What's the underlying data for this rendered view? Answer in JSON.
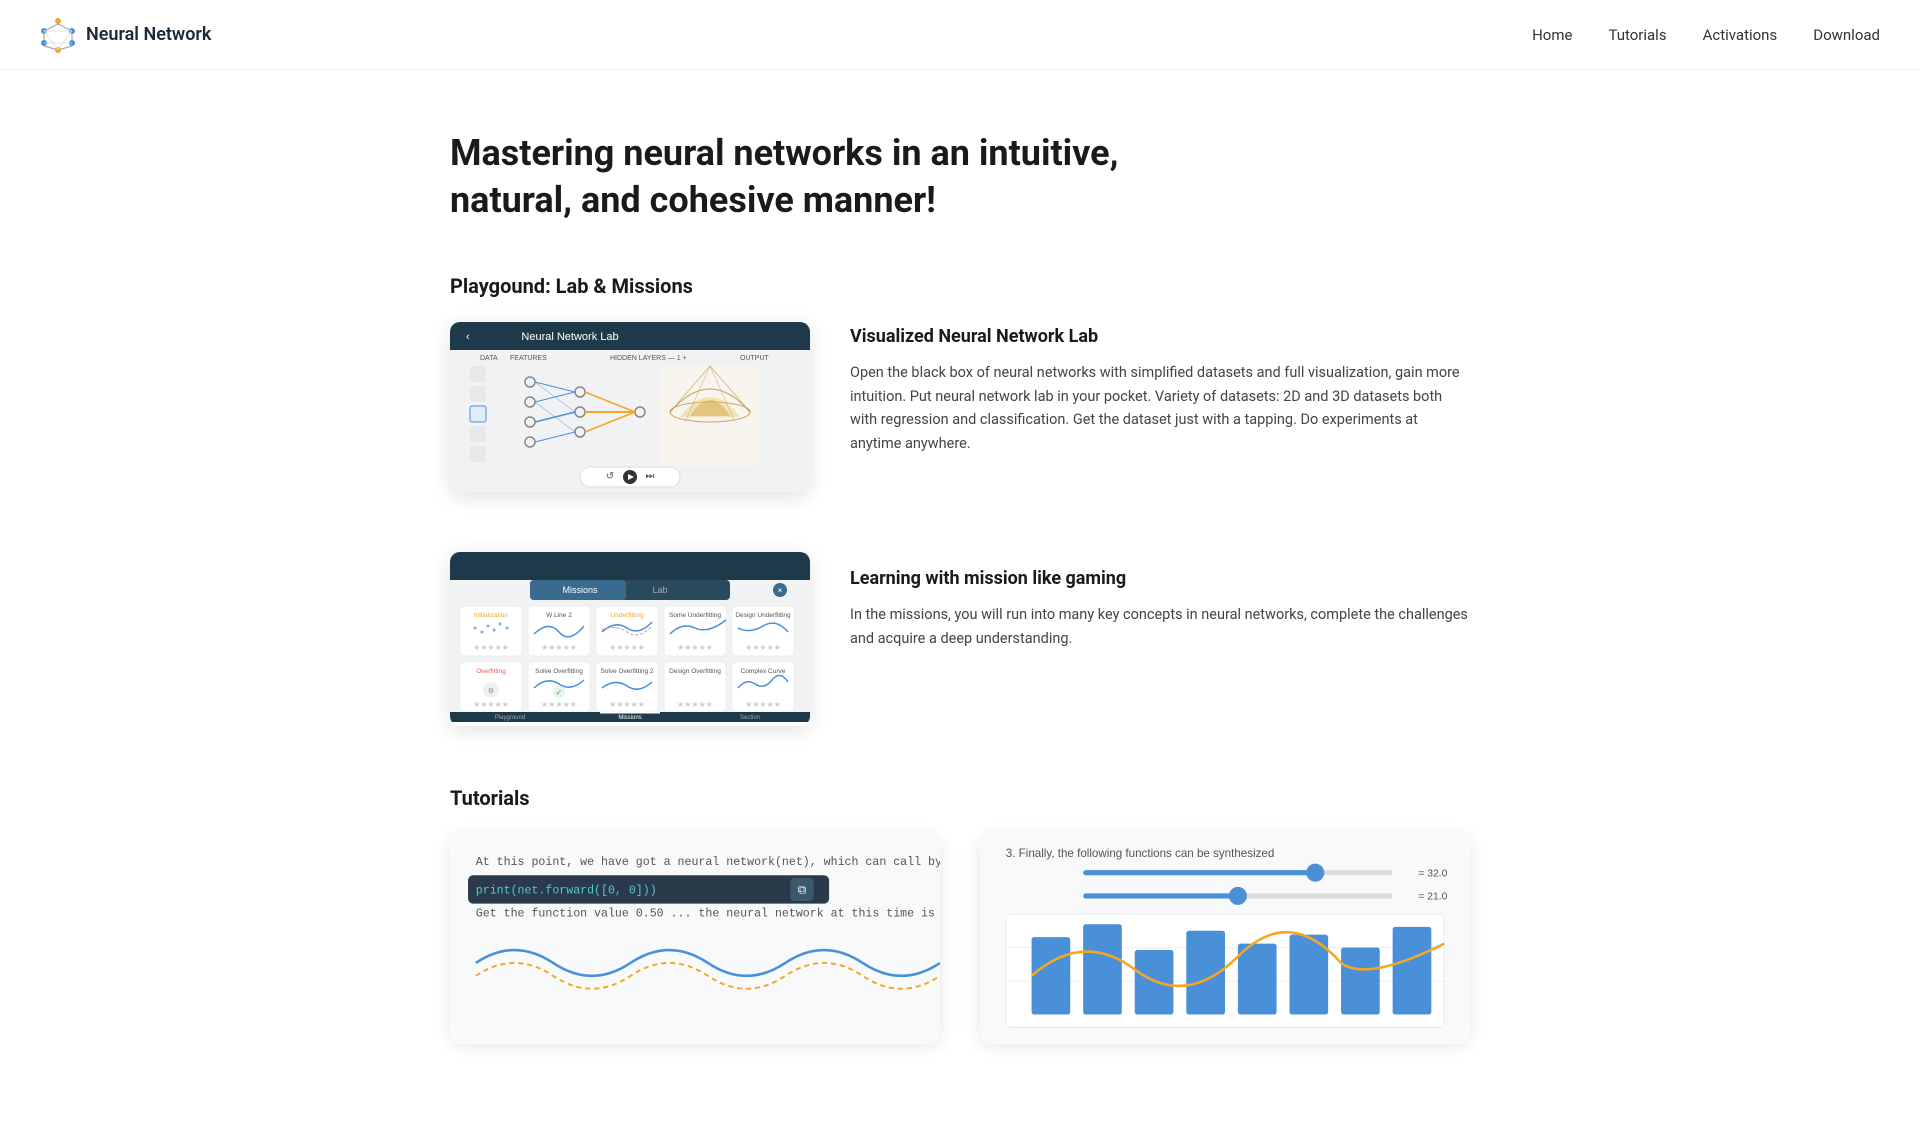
{
  "nav": {
    "logo_text": "Neural Network",
    "links": [
      "Home",
      "Tutorials",
      "Activations",
      "Download"
    ]
  },
  "hero": {
    "title": "Mastering neural networks in an intuitive, natural, and cohesive manner!"
  },
  "playground_section": {
    "title": "Playgound: Lab & Missions"
  },
  "lab_feature": {
    "title": "Visualized Neural Network Lab",
    "description": "Open the black box of neural networks with simplified datasets and full visualization, gain more intuition.\nPut neural network lab in your pocket. Variety of datasets: 2D and 3D datasets both with regression and classification. Get the dataset just with a tapping. Do experiments at anytime anywhere."
  },
  "missions_feature": {
    "title": "Learning with mission like gaming",
    "description": "In the missions, you will run into many key concepts in neural networks, complete the challenges and acquire a deep understanding."
  },
  "tutorials_section": {
    "title": "Tutorials"
  },
  "colors": {
    "nav_dark": "#1a2a3a",
    "accent": "#0077cc",
    "lab_bar": "#1e3a4a",
    "orange": "#f5a623",
    "blue_line": "#4a90d9"
  }
}
